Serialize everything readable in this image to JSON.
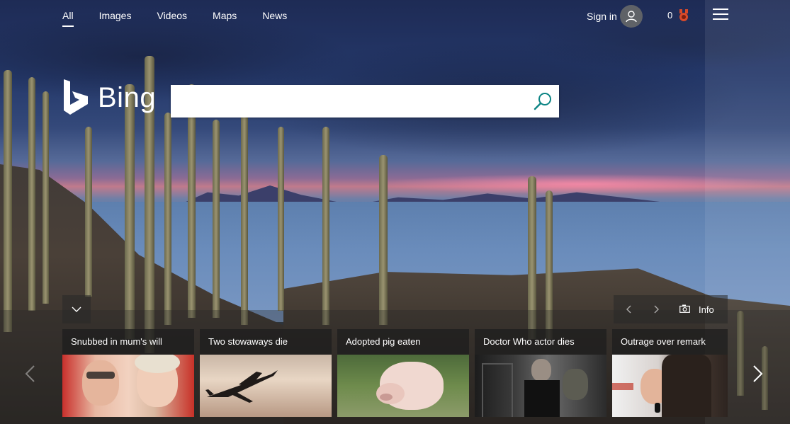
{
  "nav": {
    "tabs": [
      {
        "label": "All",
        "active": true
      },
      {
        "label": "Images",
        "active": false
      },
      {
        "label": "Videos",
        "active": false
      },
      {
        "label": "Maps",
        "active": false
      },
      {
        "label": "News",
        "active": false
      }
    ],
    "signin_label": "Sign in",
    "rewards_count": "0"
  },
  "logo": {
    "text": "Bing"
  },
  "search": {
    "placeholder": "",
    "value": ""
  },
  "infobar": {
    "info_label": "Info"
  },
  "news": [
    {
      "caption": "Snubbed in mum's will"
    },
    {
      "caption": "Two stowaways die"
    },
    {
      "caption": "Adopted pig eaten"
    },
    {
      "caption": "Doctor Who actor dies"
    },
    {
      "caption": "Outrage over remark"
    }
  ],
  "colors": {
    "accent": "#0c8484",
    "rewards_medal": "#d84a2a"
  },
  "icons": [
    "user-avatar-icon",
    "rewards-medal-icon",
    "hamburger-menu-icon",
    "search-icon",
    "chevron-down-icon",
    "chevron-left-icon",
    "chevron-right-icon",
    "camera-icon"
  ]
}
